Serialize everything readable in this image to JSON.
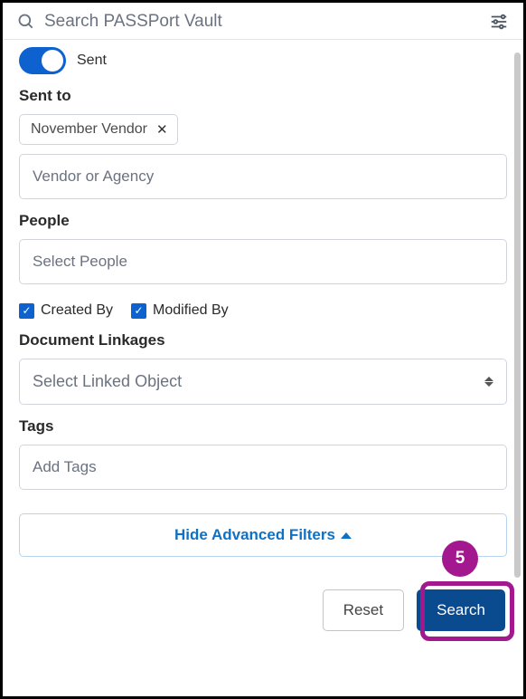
{
  "header": {
    "search_placeholder": "Search PASSPort Vault"
  },
  "toggle": {
    "label": "Sent",
    "on": true
  },
  "sent_to": {
    "label": "Sent to",
    "chip": "November Vendor",
    "input_placeholder": "Vendor or Agency"
  },
  "people": {
    "label": "People",
    "input_placeholder": "Select People"
  },
  "checkboxes": {
    "created_by": {
      "label": "Created By",
      "checked": true
    },
    "modified_by": {
      "label": "Modified By",
      "checked": true
    }
  },
  "linkages": {
    "label": "Document Linkages",
    "placeholder": "Select Linked Object"
  },
  "tags": {
    "label": "Tags",
    "placeholder": "Add Tags"
  },
  "hide_filters": "Hide Advanced Filters",
  "buttons": {
    "reset": "Reset",
    "search": "Search"
  },
  "callout": {
    "number": "5"
  }
}
